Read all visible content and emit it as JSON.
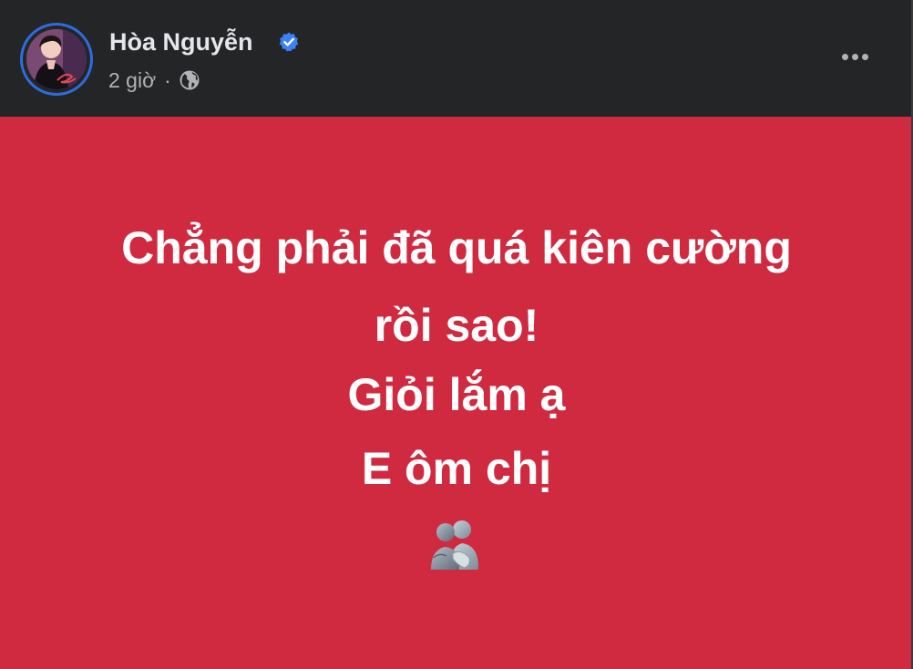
{
  "post": {
    "author": {
      "name": "Hòa Nguyễn",
      "verified": true,
      "avatar_ring_color": "#2d6cdf"
    },
    "timestamp": "2 giờ",
    "separator": "·",
    "audience_icon": "globe-icon",
    "more_icon": "more-options-icon",
    "background_color": "#d02a40",
    "status_lines": [
      "Chẳng phải đã quá kiên cường",
      "rồi sao!",
      "Giỏi lắm ạ",
      "E ôm chị"
    ],
    "emoji": "people-hugging-emoji"
  }
}
